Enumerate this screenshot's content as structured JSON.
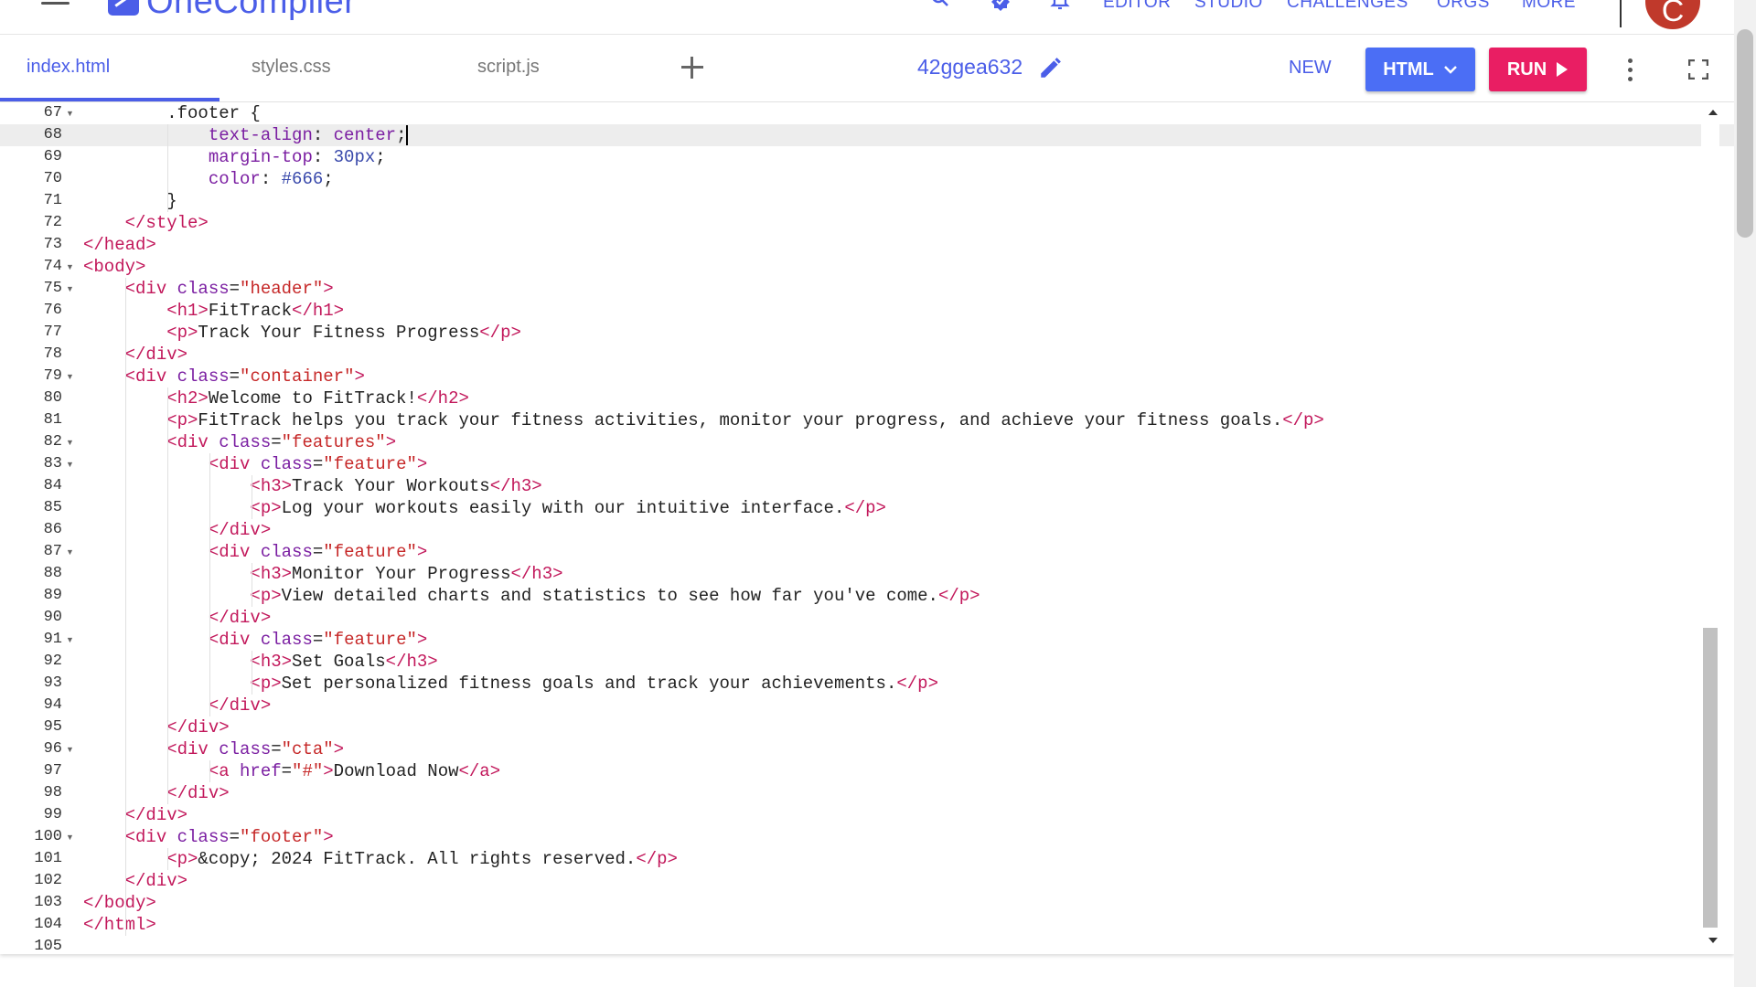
{
  "topnav": {
    "logo": "OneCompiler",
    "links": [
      "EDITOR",
      "STUDIO",
      "CHALLENGES",
      "ORGS",
      "MORE"
    ],
    "avatar_initial": "C",
    "icons": [
      "hamburger-icon",
      "search-icon",
      "verified-badge-icon",
      "bell-icon"
    ]
  },
  "tabs": {
    "items": [
      "index.html",
      "styles.css",
      "script.js"
    ],
    "active": "index.html"
  },
  "toolbar": {
    "project_id": "42ggea632",
    "new_label": "NEW",
    "language": "HTML",
    "run_label": "RUN"
  },
  "colors": {
    "accent": "#4b5ee8",
    "run": "#e91e63",
    "language_button": "#4b6ef5"
  },
  "editor": {
    "lines": [
      {
        "n": "67",
        "fold": true
      },
      {
        "n": "68",
        "fold": false
      },
      {
        "n": "69",
        "fold": false
      },
      {
        "n": "70",
        "fold": false
      },
      {
        "n": "71",
        "fold": false
      },
      {
        "n": "72",
        "fold": false
      },
      {
        "n": "73",
        "fold": false
      },
      {
        "n": "74",
        "fold": true
      },
      {
        "n": "75",
        "fold": true
      },
      {
        "n": "76",
        "fold": false
      },
      {
        "n": "77",
        "fold": false
      },
      {
        "n": "78",
        "fold": false
      },
      {
        "n": "79",
        "fold": true
      },
      {
        "n": "80",
        "fold": false
      },
      {
        "n": "81",
        "fold": false
      },
      {
        "n": "82",
        "fold": true
      },
      {
        "n": "83",
        "fold": true
      },
      {
        "n": "84",
        "fold": false
      },
      {
        "n": "85",
        "fold": false
      },
      {
        "n": "86",
        "fold": false
      },
      {
        "n": "87",
        "fold": true
      },
      {
        "n": "88",
        "fold": false
      },
      {
        "n": "89",
        "fold": false
      },
      {
        "n": "90",
        "fold": false
      },
      {
        "n": "91",
        "fold": true
      },
      {
        "n": "92",
        "fold": false
      },
      {
        "n": "93",
        "fold": false
      },
      {
        "n": "94",
        "fold": false
      },
      {
        "n": "95",
        "fold": false
      },
      {
        "n": "96",
        "fold": true
      },
      {
        "n": "97",
        "fold": false
      },
      {
        "n": "98",
        "fold": false
      },
      {
        "n": "99",
        "fold": false
      },
      {
        "n": "100",
        "fold": true
      },
      {
        "n": "101",
        "fold": false
      },
      {
        "n": "102",
        "fold": false
      },
      {
        "n": "103",
        "fold": false
      },
      {
        "n": "104",
        "fold": false
      },
      {
        "n": "105",
        "fold": false
      }
    ],
    "active_line": "68",
    "code": [
      [
        [
          "tx",
          "        .footer {"
        ]
      ],
      [
        [
          "cs",
          "            text-align"
        ],
        [
          "tx",
          ": "
        ],
        [
          "cs",
          "center"
        ],
        [
          "tx",
          ";"
        ],
        [
          "cursor",
          ""
        ]
      ],
      [
        [
          "cs",
          "            margin-top"
        ],
        [
          "tx",
          ": "
        ],
        [
          "nm",
          "30px"
        ],
        [
          "tx",
          ";"
        ]
      ],
      [
        [
          "cs",
          "            color"
        ],
        [
          "tx",
          ": "
        ],
        [
          "nm",
          "#666"
        ],
        [
          "tx",
          ";"
        ]
      ],
      [
        [
          "tx",
          "        }"
        ]
      ],
      [
        [
          "tg",
          "    </style>"
        ]
      ],
      [
        [
          "tg",
          "</head>"
        ]
      ],
      [
        [
          "tg",
          "<body>"
        ]
      ],
      [
        [
          "tg",
          "    <div "
        ],
        [
          "at",
          "class"
        ],
        [
          "tx",
          "="
        ],
        [
          "st",
          "\"header\""
        ],
        [
          "tg",
          ">"
        ]
      ],
      [
        [
          "tg",
          "        <h1>"
        ],
        [
          "tx",
          "FitTrack"
        ],
        [
          "tg",
          "</h1>"
        ]
      ],
      [
        [
          "tg",
          "        <p>"
        ],
        [
          "tx",
          "Track Your Fitness Progress"
        ],
        [
          "tg",
          "</p>"
        ]
      ],
      [
        [
          "tg",
          "    </div>"
        ]
      ],
      [
        [
          "tg",
          "    <div "
        ],
        [
          "at",
          "class"
        ],
        [
          "tx",
          "="
        ],
        [
          "st",
          "\"container\""
        ],
        [
          "tg",
          ">"
        ]
      ],
      [
        [
          "tg",
          "        <h2>"
        ],
        [
          "tx",
          "Welcome to FitTrack!"
        ],
        [
          "tg",
          "</h2>"
        ]
      ],
      [
        [
          "tg",
          "        <p>"
        ],
        [
          "tx",
          "FitTrack helps you track your fitness activities, monitor your progress, and achieve your fitness goals."
        ],
        [
          "tg",
          "</p>"
        ]
      ],
      [
        [
          "tg",
          "        <div "
        ],
        [
          "at",
          "class"
        ],
        [
          "tx",
          "="
        ],
        [
          "st",
          "\"features\""
        ],
        [
          "tg",
          ">"
        ]
      ],
      [
        [
          "tg",
          "            <div "
        ],
        [
          "at",
          "class"
        ],
        [
          "tx",
          "="
        ],
        [
          "st",
          "\"feature\""
        ],
        [
          "tg",
          ">"
        ]
      ],
      [
        [
          "tg",
          "                <h3>"
        ],
        [
          "tx",
          "Track Your Workouts"
        ],
        [
          "tg",
          "</h3>"
        ]
      ],
      [
        [
          "tg",
          "                <p>"
        ],
        [
          "tx",
          "Log your workouts easily with our intuitive interface."
        ],
        [
          "tg",
          "</p>"
        ]
      ],
      [
        [
          "tg",
          "            </div>"
        ]
      ],
      [
        [
          "tg",
          "            <div "
        ],
        [
          "at",
          "class"
        ],
        [
          "tx",
          "="
        ],
        [
          "st",
          "\"feature\""
        ],
        [
          "tg",
          ">"
        ]
      ],
      [
        [
          "tg",
          "                <h3>"
        ],
        [
          "tx",
          "Monitor Your Progress"
        ],
        [
          "tg",
          "</h3>"
        ]
      ],
      [
        [
          "tg",
          "                <p>"
        ],
        [
          "tx",
          "View detailed charts and statistics to see how far you've come."
        ],
        [
          "tg",
          "</p>"
        ]
      ],
      [
        [
          "tg",
          "            </div>"
        ]
      ],
      [
        [
          "tg",
          "            <div "
        ],
        [
          "at",
          "class"
        ],
        [
          "tx",
          "="
        ],
        [
          "st",
          "\"feature\""
        ],
        [
          "tg",
          ">"
        ]
      ],
      [
        [
          "tg",
          "                <h3>"
        ],
        [
          "tx",
          "Set Goals"
        ],
        [
          "tg",
          "</h3>"
        ]
      ],
      [
        [
          "tg",
          "                <p>"
        ],
        [
          "tx",
          "Set personalized fitness goals and track your achievements."
        ],
        [
          "tg",
          "</p>"
        ]
      ],
      [
        [
          "tg",
          "            </div>"
        ]
      ],
      [
        [
          "tg",
          "        </div>"
        ]
      ],
      [
        [
          "tg",
          "        <div "
        ],
        [
          "at",
          "class"
        ],
        [
          "tx",
          "="
        ],
        [
          "st",
          "\"cta\""
        ],
        [
          "tg",
          ">"
        ]
      ],
      [
        [
          "tg",
          "            <a "
        ],
        [
          "at",
          "href"
        ],
        [
          "tx",
          "="
        ],
        [
          "st",
          "\"#\""
        ],
        [
          "tg",
          ">"
        ],
        [
          "tx",
          "Download Now"
        ],
        [
          "tg",
          "</a>"
        ]
      ],
      [
        [
          "tg",
          "        </div>"
        ]
      ],
      [
        [
          "tg",
          "    </div>"
        ]
      ],
      [
        [
          "tg",
          "    <div "
        ],
        [
          "at",
          "class"
        ],
        [
          "tx",
          "="
        ],
        [
          "st",
          "\"footer\""
        ],
        [
          "tg",
          ">"
        ]
      ],
      [
        [
          "tg",
          "        <p>"
        ],
        [
          "tx",
          "&copy; 2024 FitTrack. All rights reserved."
        ],
        [
          "tg",
          "</p>"
        ]
      ],
      [
        [
          "tg",
          "    </div>"
        ]
      ],
      [
        [
          "tg",
          "</body>"
        ]
      ],
      [
        [
          "tg",
          "</html>"
        ]
      ],
      []
    ]
  }
}
